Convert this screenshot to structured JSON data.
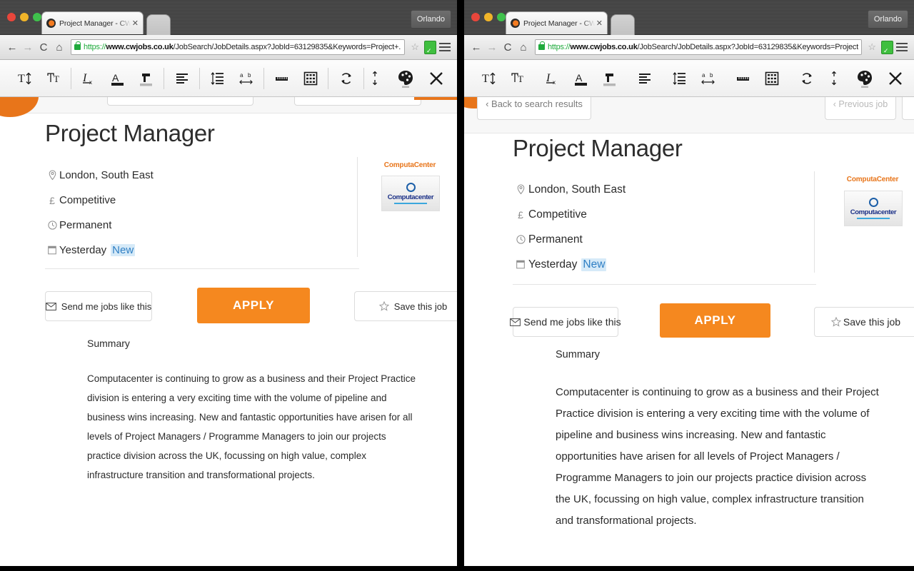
{
  "browser": {
    "tab_title": "Project Manager - CWJobs",
    "tab_close": "✕",
    "profile_name": "Orlando",
    "url_scheme": "https://",
    "url_host": "www.cwjobs.co.uk",
    "url_path": "/JobSearch/JobDetails.aspx?JobId=63129835&Keywords=Project+...",
    "back_arrow": "←",
    "forward_arrow": "→",
    "reload": "C",
    "home": "⌂",
    "bookmark_star": "☆"
  },
  "toolbar": {
    "icons": [
      {
        "name": "increase-font-size-icon",
        "title": "Increase font size"
      },
      {
        "name": "decrease-font-size-icon",
        "title": "Decrease font size"
      },
      {
        "name": "clear-formatting-icon",
        "title": "Clear formatting"
      },
      {
        "name": "font-color-icon",
        "title": "Font colour"
      },
      {
        "name": "highlight-color-icon",
        "title": "Highlight colour"
      },
      {
        "name": "text-align-icon",
        "title": "Text alignment"
      },
      {
        "name": "line-spacing-icon",
        "title": "Line spacing"
      },
      {
        "name": "letter-spacing-icon",
        "title": "Letter spacing"
      },
      {
        "name": "reading-ruler-icon",
        "title": "Reading ruler"
      },
      {
        "name": "reading-mask-icon",
        "title": "Reading mask"
      },
      {
        "name": "reset-icon",
        "title": "Reset"
      }
    ],
    "right_icons": [
      {
        "name": "resize-vertical-icon",
        "title": "Resize"
      },
      {
        "name": "color-palette-icon",
        "title": "Colour theme"
      },
      {
        "name": "close-toolbar-icon",
        "title": "Close"
      }
    ]
  },
  "page": {
    "back_to_results": "‹ Back to search results",
    "previous_job": "‹ Previous job",
    "job_title": "Project Manager",
    "meta": [
      {
        "icon": "location-pin-icon",
        "glyph": "⚲",
        "label": "London, South East"
      },
      {
        "icon": "salary-pound-icon",
        "glyph": "£",
        "label": "Competitive"
      },
      {
        "icon": "contract-type-icon",
        "glyph": "◔",
        "label": "Permanent"
      },
      {
        "icon": "date-posted-icon",
        "glyph": "▤",
        "label": "Yesterday",
        "badge": "New"
      }
    ],
    "company_name": "ComputaCenter",
    "company_logo_text": "Computacenter",
    "buttons": {
      "send_jobs": "Send me jobs like this",
      "apply": "APPLY",
      "save_job": "Save this job"
    },
    "summary_heading": "Summary",
    "summary_body": "Computacenter is continuing to grow as a business and their Project Practice division is entering a very exciting time with the volume of pipeline and business wins increasing. New and fantastic opportunities have arisen for all levels of Project Managers / Programme Managers to join our projects practice division across the UK, focussing on high value, complex infrastructure transition and transformational projects."
  },
  "colors": {
    "brand_orange": "#e8751a",
    "apply_orange": "#f5881f",
    "badge_blue": "#2f7fc4",
    "badge_bg": "#d6eaf8",
    "logo_blue": "#1a2f86"
  }
}
